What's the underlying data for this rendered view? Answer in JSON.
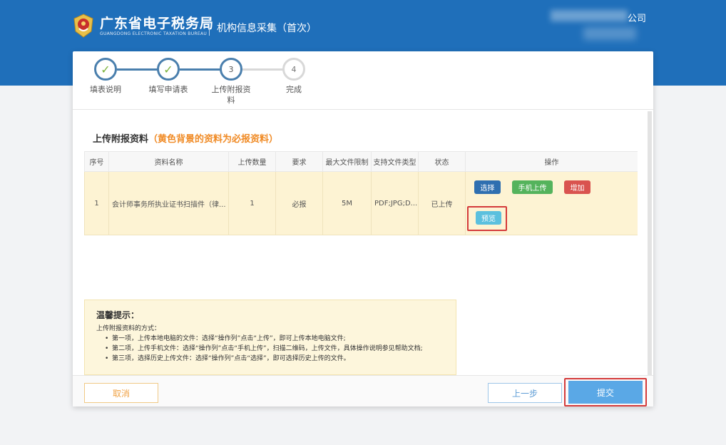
{
  "header": {
    "brand_cn": "广东省电子税务局",
    "brand_en": "GUANGDONG ELECTRONIC TAXATION BUREAU",
    "subtitle": "机构信息采集（首次）",
    "company_suffix": "公司"
  },
  "steps": [
    {
      "number": "",
      "label": "填表说明",
      "status": "done"
    },
    {
      "number": "",
      "label": "填写申请表",
      "status": "done"
    },
    {
      "number": "3",
      "label": "上传附报资料",
      "status": "current"
    },
    {
      "number": "4",
      "label": "完成",
      "status": "todo"
    }
  ],
  "section": {
    "title": "上传附报资料",
    "note": "（黄色背景的资料为必报资料）"
  },
  "table": {
    "headers": [
      "序号",
      "资料名称",
      "上传数量",
      "要求",
      "最大文件限制",
      "支持文件类型",
      "状态",
      "操作"
    ],
    "rows": [
      {
        "index": "1",
        "name": "会计师事务所执业证书扫描件（律...",
        "count": "1",
        "requirement": "必报",
        "max_size": "5M",
        "file_types": "PDF;JPG;D...",
        "status": "已上传",
        "actions": {
          "select": "选择",
          "mobile_upload": "手机上传",
          "add": "增加",
          "preview": "预览"
        }
      }
    ]
  },
  "tips": {
    "title": "温馨提示：",
    "intro": "上传附报资料的方式：",
    "items": [
      "第一项，上传本地电脑的文件：选择“操作列”点击“上传”，即可上传本地电脑文件;",
      "第二项，上传手机文件：选择“操作列”点击“手机上传”，扫描二维码，上传文件，具体操作说明参见帮助文档;",
      "第三项，选择历史上传文件：选择“操作列”点击“选择”，即可选择历史上传的文件。"
    ]
  },
  "footer": {
    "cancel": "取消",
    "prev": "上一步",
    "submit": "提交"
  },
  "colors": {
    "header_bg": "#1f6fba",
    "required_row_bg": "#fdf3d3",
    "highlight_box": "#d43a3a",
    "note_orange": "#f08a24"
  }
}
